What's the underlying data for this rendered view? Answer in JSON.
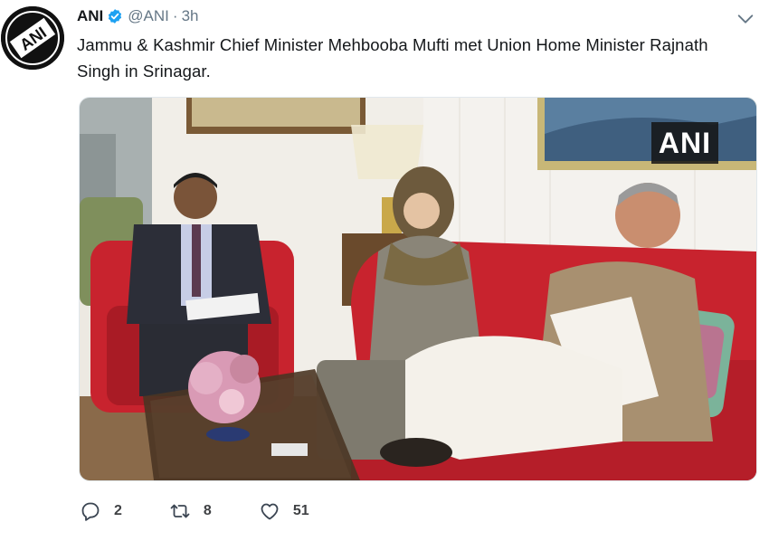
{
  "tweet": {
    "author_name": "ANI",
    "author_handle": "@ANI",
    "separator": "·",
    "timestamp": "3h",
    "avatar_icon": "ani-logo-icon",
    "text": "Jammu & Kashmir Chief Minister Mehbooba Mufti met Union Home Minister Rajnath Singh in Srinagar.",
    "media": {
      "watermark": "ANI"
    },
    "actions": {
      "reply_count": "2",
      "retweet_count": "8",
      "like_count": "51"
    }
  },
  "colors": {
    "accent": "#1da1f2",
    "secondary_text": "#657786",
    "primary_text": "#14171a"
  }
}
